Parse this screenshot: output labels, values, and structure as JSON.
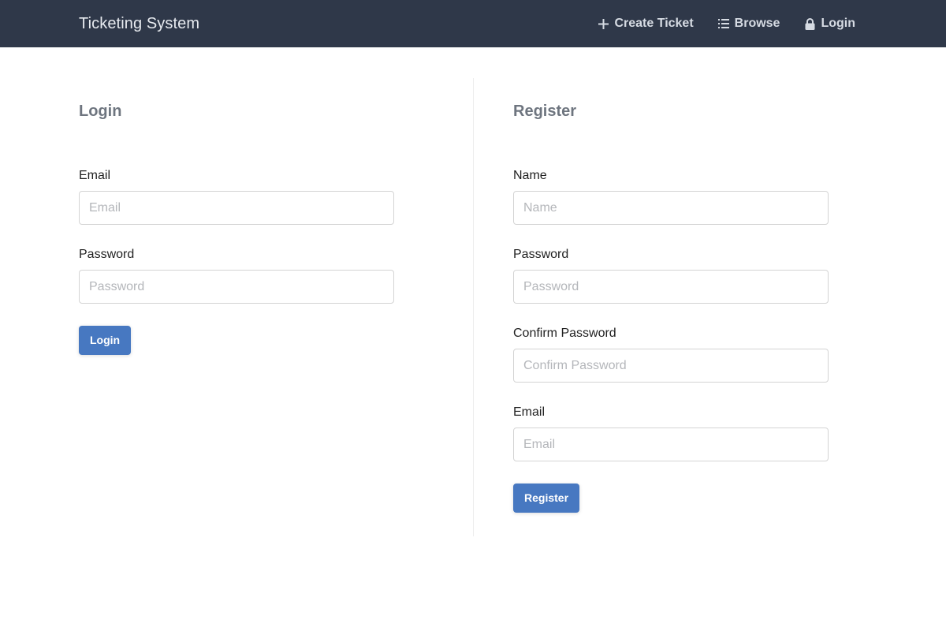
{
  "app": {
    "title": "Ticketing System"
  },
  "nav": {
    "items": [
      {
        "label": "Create Ticket",
        "icon": "plus-icon"
      },
      {
        "label": "Browse",
        "icon": "list-icon"
      },
      {
        "label": "Login",
        "icon": "lock-icon"
      }
    ]
  },
  "login": {
    "title": "Login",
    "fields": [
      {
        "label": "Email",
        "placeholder": "Email",
        "value": ""
      },
      {
        "label": "Password",
        "placeholder": "Password",
        "value": ""
      }
    ],
    "submit_label": "Login"
  },
  "register": {
    "title": "Register",
    "fields": [
      {
        "label": "Name",
        "placeholder": "Name",
        "value": ""
      },
      {
        "label": "Password",
        "placeholder": "Password",
        "value": ""
      },
      {
        "label": "Confirm Password",
        "placeholder": "Confirm Password",
        "value": ""
      },
      {
        "label": "Email",
        "placeholder": "Email",
        "value": ""
      }
    ],
    "submit_label": "Register"
  },
  "colors": {
    "navbar_bg": "#2f3849",
    "primary": "#4778c1"
  }
}
